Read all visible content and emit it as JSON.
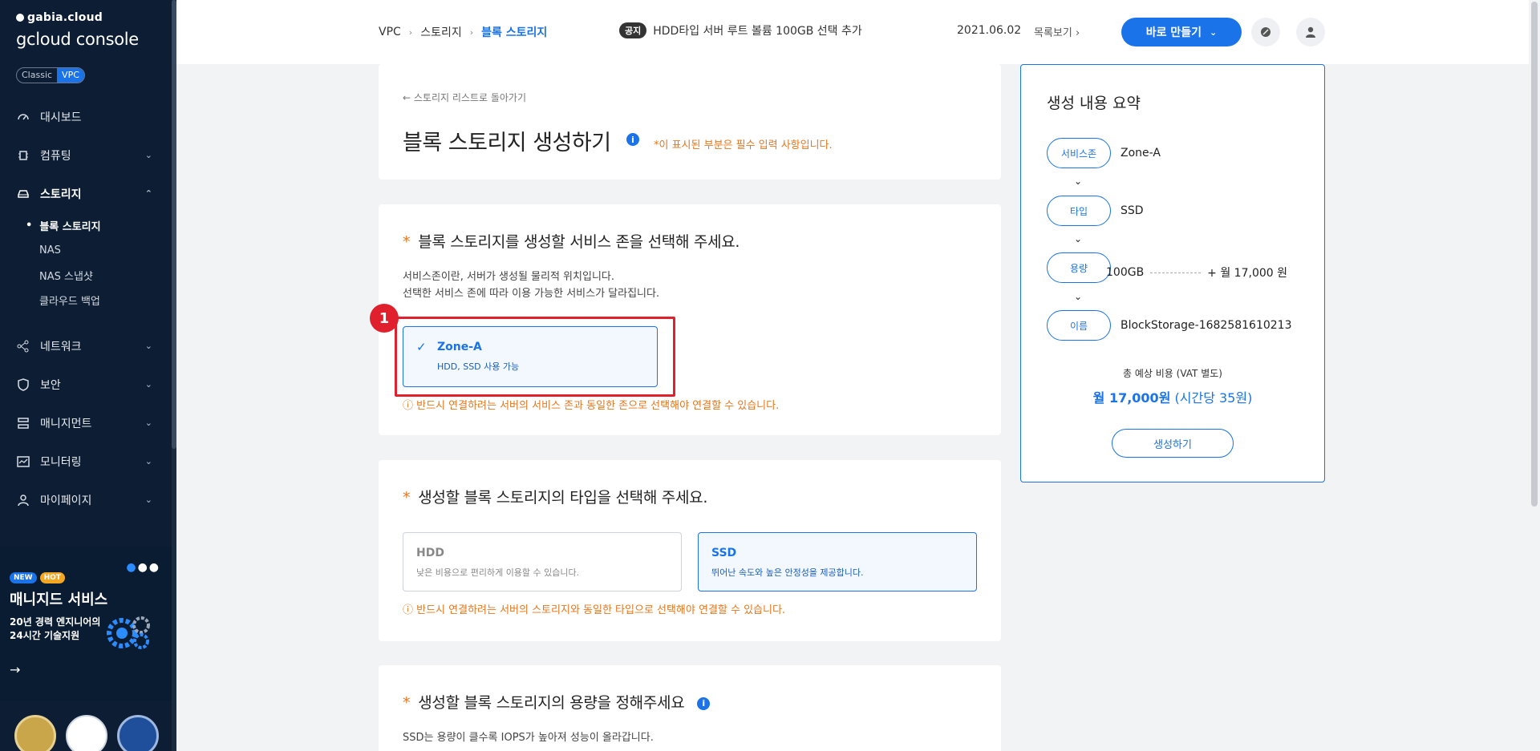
{
  "sidebar": {
    "brand_small": "gabia.cloud",
    "brand_main": "gcloud console",
    "toggle": {
      "classic": "Classic",
      "vpc": "VPC"
    },
    "nav": [
      {
        "label": "대시보드",
        "icon": "dashboard-icon"
      },
      {
        "label": "컴퓨팅",
        "icon": "computing-icon"
      },
      {
        "label": "스토리지",
        "icon": "storage-icon"
      },
      {
        "label": "네트워크",
        "icon": "network-icon"
      },
      {
        "label": "보안",
        "icon": "security-icon"
      },
      {
        "label": "매니지먼트",
        "icon": "management-icon"
      },
      {
        "label": "모니터링",
        "icon": "monitoring-icon"
      },
      {
        "label": "마이페이지",
        "icon": "mypage-icon"
      }
    ],
    "storage_sub": [
      "블록 스토리지",
      "NAS",
      "NAS 스냅샷",
      "클라우드 백업"
    ],
    "promo": {
      "badge_new": "NEW",
      "badge_hot": "HOT",
      "title": "매니지드 서비스",
      "subtitle": "20년 경력 엔지니어의 24시간 기술지원"
    }
  },
  "header": {
    "breadcrumb": [
      "VPC",
      "스토리지",
      "블록 스토리지"
    ],
    "notice_tag": "공지",
    "notice_text": "HDD타입 서버 루트 볼륨 100GB 선택 추가",
    "notice_date": "2021.06.02",
    "notice_more": "목록보기",
    "create_button": "바로 만들기"
  },
  "head_card": {
    "back_link": "스토리지 리스트로 돌아가기",
    "title": "블록 스토리지 생성하기",
    "required_note": "*이 표시된 부분은 필수 입력 사항입니다."
  },
  "zone_section": {
    "title": "블록 스토리지를 생성할 서비스 존을 선택해 주세요.",
    "desc1": "서비스존이란, 서버가 생성될 물리적 위치입니다.",
    "desc2": "선택한 서비스 존에 따라 이용 가능한 서비스가 달라집니다.",
    "option_title": "Zone-A",
    "option_sub": "HDD, SSD 사용 가능",
    "warning": "반드시 연결하려는 서버의 서비스 존과 동일한 존으로 선택해야 연결할 수 있습니다.",
    "step": "1"
  },
  "type_section": {
    "title": "생성할 블록 스토리지의 타입을 선택해 주세요.",
    "hdd_title": "HDD",
    "hdd_sub": "낮은 비용으로 편리하게 이용할 수 있습니다.",
    "ssd_title": "SSD",
    "ssd_sub": "뛰어난 속도와 높은 안정성을 제공합니다.",
    "warning": "반드시 연결하려는 서버의 스토리지와 동일한 타입으로 선택해야 연결할 수 있습니다."
  },
  "capacity_section": {
    "title": "생성할 블록 스토리지의 용량을 정해주세요",
    "desc1": "SSD는 용량이 클수록 IOPS가 높아져 성능이 올라갑니다."
  },
  "summary": {
    "title": "생성 내용 요약",
    "zone_label": "서비스존",
    "zone_value": "Zone-A",
    "type_label": "타입",
    "type_value": "SSD",
    "cap_label": "용량",
    "cap_value": "100GB",
    "cap_price": "+ 월 17,000 원",
    "name_label": "이름",
    "name_value": "BlockStorage-1682581610213",
    "total_label": "총 예상 비용 (VAT 별도)",
    "total_monthly": "월 17,000원",
    "total_hourly": "(시간당 35원)",
    "generate_button": "생성하기"
  },
  "colors": {
    "accent": "#1a73e8",
    "warning": "#e5771f",
    "sidebar": "#0d1d33",
    "highlight": "#e0202c"
  }
}
